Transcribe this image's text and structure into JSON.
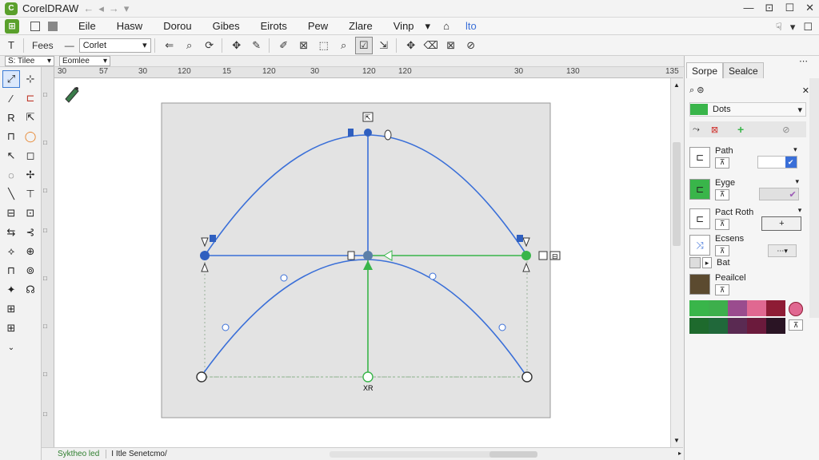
{
  "window": {
    "title": "CorelDRAW",
    "nav_back": "←",
    "nav_back2": "◂",
    "nav_fwd": "→",
    "nav_more": "▾",
    "ctrl_min": "—",
    "ctrl_max": "☐",
    "ctrl_close": "✕",
    "ctrl_restore": "⊡"
  },
  "menu": {
    "items": [
      "Eile",
      "Hasw",
      "Dorou",
      "Gibes",
      "Eirots",
      "Pew",
      "Zlare",
      "Vinp"
    ],
    "extra_arrow": "▾",
    "extra_home": "⌂",
    "extra_label": "lto",
    "right_icons": [
      "☟",
      "▾",
      "☐"
    ]
  },
  "toolbar": {
    "first_icon": "T",
    "label": "Fees",
    "line_sample": "—",
    "combo_value": "Corlet",
    "combo_arrow": "▾",
    "icons": [
      "⇐",
      "⌕",
      "⟳",
      "✥",
      "✎",
      "✐",
      "⊠",
      "⬚",
      "☑",
      "⇲",
      "⌫",
      "⊘"
    ]
  },
  "propbar": {
    "combo1": "S: Tilee",
    "combo2": "Eomlee",
    "arrow": "▾"
  },
  "toolbox": {
    "tools": [
      "⤢",
      "⊹",
      "⁄",
      "⊏",
      "R",
      "⇱",
      "⊓",
      "◯",
      "↖",
      "◻",
      "◌",
      "✢",
      "╲",
      "⊤",
      "⊟",
      "⊡",
      "⇆",
      "⊰",
      "⟡",
      "⊕",
      "⊓",
      "⊚",
      "✦",
      "☊",
      "⊞",
      "",
      ""
    ]
  },
  "ruler": {
    "ticks": [
      "30",
      "57",
      "30",
      "120",
      "15",
      "120",
      "30",
      "120",
      "120",
      "30",
      "130",
      "135"
    ],
    "corner": "135"
  },
  "canvas": {
    "top_handle": "⇱",
    "right_handle": "⊟",
    "bottom_label": "XR"
  },
  "status": {
    "left": "Syktheo led",
    "mid": "I Itle Senetcmo/"
  },
  "panel": {
    "tabs": [
      "Sorpe",
      "Sealce"
    ],
    "search_icon": "⌕",
    "search_text": "⌕ ⊜",
    "close_icon": "✕",
    "layer_name": "Dots",
    "layer_arrow": "▾",
    "rows": [
      {
        "label": "Path",
        "small": "⊼",
        "checkbox": "✔"
      },
      {
        "label": "Eyge",
        "small": "⊼",
        "checkbox": "✔"
      },
      {
        "label": "Pact Roth",
        "small": "⊼",
        "checkbox": "+"
      },
      {
        "label": "Ecsens",
        "small": "⊼",
        "checkbox": "⋯"
      },
      {
        "label": "Bat",
        "small": "▸",
        "checkbox": ""
      },
      {
        "label": "Peailcel",
        "small": "⊼",
        "checkbox": ""
      }
    ],
    "plus": "+",
    "green_icon": "⊞",
    "swatch_top": [
      "#39b54a",
      "#3daf4c",
      "#9a4c8e",
      "#e06891",
      "#8e1c35"
    ],
    "swatch_bottom": [
      "#1e6a2d",
      "#20683a",
      "#5a2a52",
      "#6b1a3c",
      "#2a1424"
    ],
    "accent_blue": "#3a6fd8",
    "accent_green": "#39b54a",
    "row_colors": [
      "#e8e8e8",
      "#e0e0e0",
      "#f0f0f0",
      "#ececec",
      "#dcdcdc",
      "#5b4a2f"
    ]
  }
}
